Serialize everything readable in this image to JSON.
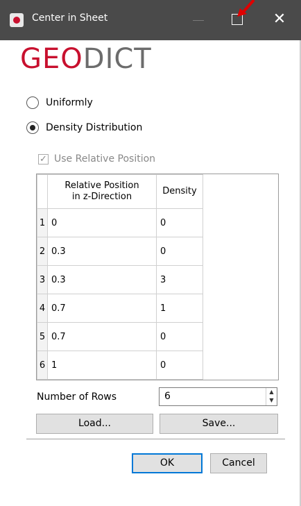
{
  "window": {
    "title": "Center in Sheet",
    "close_glyph": "✕"
  },
  "logo": {
    "part1": "GEO",
    "part2": "DICT"
  },
  "options": {
    "uniformly": "Uniformly",
    "density_distribution": "Density Distribution",
    "selected": "density_distribution"
  },
  "use_relative_position": {
    "label": "Use Relative Position",
    "checked": true,
    "enabled": false
  },
  "table": {
    "headers": [
      "Relative Position\nin z-Direction",
      "Density"
    ],
    "rows": [
      {
        "num": "1",
        "position": "0",
        "density": "0"
      },
      {
        "num": "2",
        "position": "0.3",
        "density": "0"
      },
      {
        "num": "3",
        "position": "0.3",
        "density": "3"
      },
      {
        "num": "4",
        "position": "0.7",
        "density": "1"
      },
      {
        "num": "5",
        "position": "0.7",
        "density": "0"
      },
      {
        "num": "6",
        "position": "1",
        "density": "0"
      }
    ]
  },
  "number_of_rows": {
    "label": "Number of Rows",
    "value": "6"
  },
  "buttons": {
    "load": "Load...",
    "save": "Save...",
    "ok": "OK",
    "cancel": "Cancel"
  },
  "colors": {
    "brand_red": "#c8102e",
    "titlebar": "#4a4a4a",
    "accent_blue": "#0078d7"
  },
  "icons": [
    "app-icon",
    "minimize-icon",
    "maximize-icon",
    "close-icon",
    "annotation-arrow-icon",
    "spin-up-icon",
    "spin-down-icon",
    "checkmark-icon"
  ]
}
